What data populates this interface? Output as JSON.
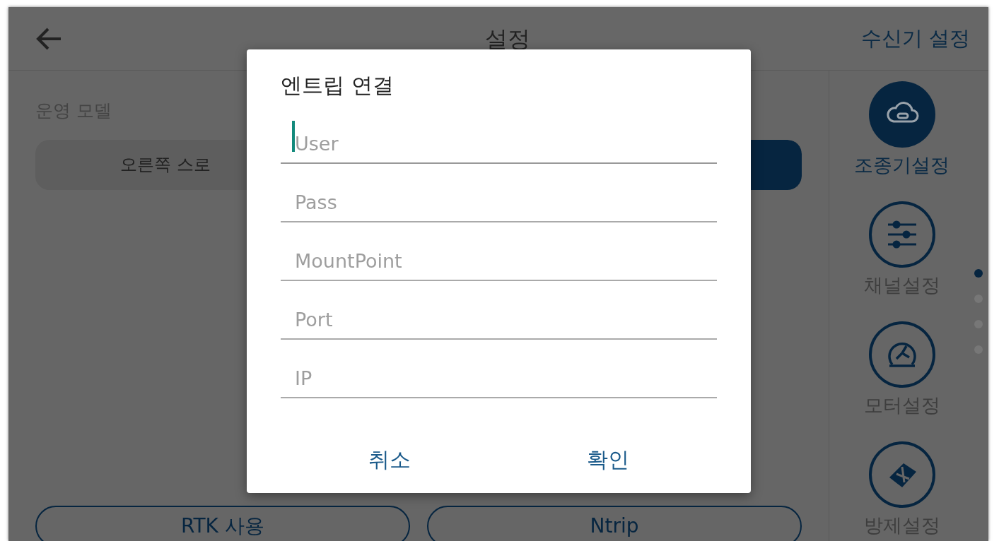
{
  "header": {
    "title": "설정",
    "action": "수신기 설정"
  },
  "section": {
    "label": "운영 모델"
  },
  "segments": [
    {
      "label": "오른쪽 스로",
      "selected": false
    },
    {
      "selected": true
    }
  ],
  "bottom_buttons": [
    "RTK 사용",
    "Ntrip"
  ],
  "sidebar": {
    "items": [
      {
        "label": "조종기설정",
        "kind": "cloud",
        "selected": true
      },
      {
        "label": "채널설정",
        "kind": "sliders",
        "selected": false
      },
      {
        "label": "모터설정",
        "kind": "motor",
        "selected": false
      },
      {
        "label": "방제설정",
        "kind": "grid",
        "selected": false
      }
    ],
    "page_dots": [
      {
        "selected": true
      },
      {
        "selected": false
      },
      {
        "selected": false
      },
      {
        "selected": false
      }
    ]
  },
  "dialog": {
    "title": "엔트립 연결",
    "fields": [
      {
        "placeholder": "User",
        "focused": true
      },
      {
        "placeholder": "Pass",
        "focused": false
      },
      {
        "placeholder": "MountPoint",
        "focused": false
      },
      {
        "placeholder": "Port",
        "focused": false
      },
      {
        "placeholder": "IP",
        "focused": false
      }
    ],
    "buttons": [
      "취소",
      "확인"
    ]
  }
}
